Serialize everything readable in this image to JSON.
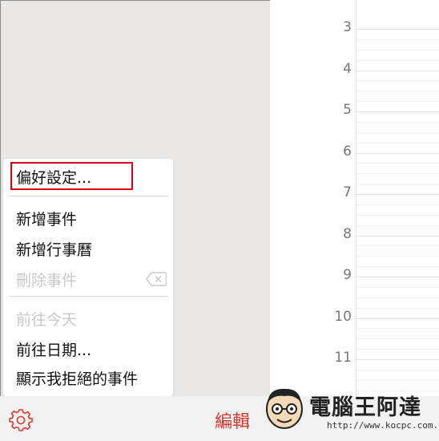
{
  "calendar": {
    "hours": [
      "3",
      "4",
      "5",
      "6",
      "7",
      "8",
      "9",
      "10",
      "11"
    ]
  },
  "menu": {
    "preferences": "偏好設定...",
    "new_event": "新增事件",
    "new_calendar": "新增行事曆",
    "delete_event": "刪除事件",
    "go_today": "前往今天",
    "go_date": "前往日期...",
    "show_declined": "顯示我拒絕的事件"
  },
  "toolbar": {
    "edit_label": "編輯",
    "settings_icon": "gear-icon"
  },
  "watermark": {
    "title": "電腦王阿達",
    "url": "http://www.kocpc.com.tw"
  },
  "colors": {
    "accent_red": "#d9382e",
    "highlight_red": "#d9001b"
  }
}
